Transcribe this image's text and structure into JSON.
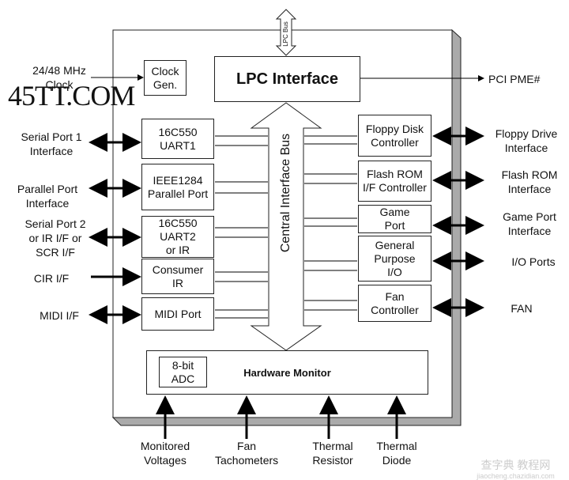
{
  "lpc_bus": "LPC Bus",
  "central_bus": "Central Interface Bus",
  "clock_input": "24/48 MHz Clock",
  "pci_pme": "PCI PME#",
  "blocks": {
    "clock_gen": "Clock Gen.",
    "lpc_interface": "LPC Interface",
    "uart1": "16C550 UART1",
    "parallel": "IEEE1284 Parallel Port",
    "uart2": "16C550 UART2 or IR",
    "consumer_ir": "Consumer IR",
    "midi": "MIDI Port",
    "floppy": "Floppy Disk Controller",
    "flash": "Flash ROM I/F Controller",
    "game": "Game Port",
    "gpio": "General Purpose I/O",
    "fan": "Fan Controller",
    "hw_monitor": "Hardware Monitor",
    "adc": "8-bit ADC"
  },
  "left_labels": [
    "Serial Port 1 Interface",
    "Parallel Port Interface",
    "Serial Port 2 or IR I/F or SCR I/F",
    "CIR I/F",
    "MIDI I/F"
  ],
  "right_labels": [
    "Floppy Drive Interface",
    "Flash ROM Interface",
    "Game Port Interface",
    "I/O Ports",
    "FAN"
  ],
  "bottom_labels": [
    "Monitored Voltages",
    "Fan Tachometers",
    "Thermal Resistor",
    "Thermal Diode"
  ],
  "watermarks": {
    "top": "45TT.COM",
    "bottom": "查字典 教程网",
    "bottom_url": "jiaocheng.chazidian.com"
  }
}
